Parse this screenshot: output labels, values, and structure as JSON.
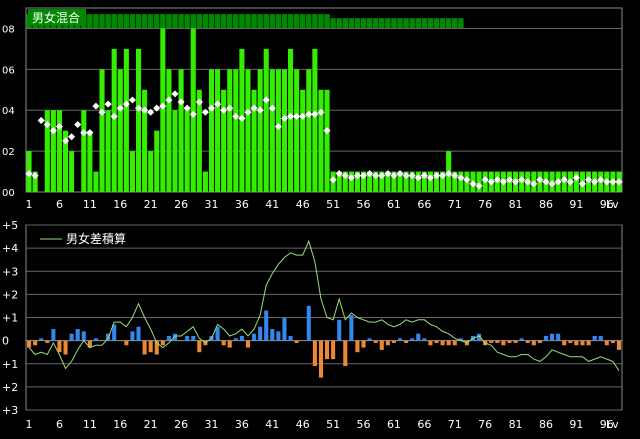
{
  "chart_data": [
    {
      "type": "bar",
      "title": "男女混合",
      "xlabel": "Lv",
      "ylabel": "",
      "xlim": [
        1,
        99
      ],
      "ylim": [
        0,
        0.09
      ],
      "x_ticks": [
        "1",
        "6",
        "11",
        "16",
        "21",
        "26",
        "31",
        "36",
        "41",
        "46",
        "51",
        "56",
        "61",
        "66",
        "71",
        "76",
        "81",
        "86",
        "91",
        "96",
        "Lv"
      ],
      "y_ticks": [
        "00",
        "02",
        "04",
        "06",
        "08"
      ],
      "bar_color": "#33ee00",
      "marker_color": "#ffffff",
      "grid": true,
      "series": [
        {
          "values": [
            0.02,
            0.01,
            0,
            0.04,
            0.04,
            0.04,
            0.03,
            0.02,
            0,
            0.04,
            0.03,
            0.01,
            0.06,
            0.04,
            0.07,
            0.06,
            0.07,
            0.02,
            0.07,
            0.05,
            0.02,
            0.03,
            0.08,
            0.06,
            0.04,
            0.06,
            0.04,
            0.08,
            0.05,
            0.01,
            0.06,
            0.06,
            0.05,
            0.06,
            0.06,
            0.07,
            0.06,
            0.05,
            0.06,
            0.07,
            0.06,
            0.06,
            0.06,
            0.07,
            0.06,
            0.05,
            0.06,
            0.07,
            0.05,
            0.05,
            0.01,
            0.01,
            0.01,
            0.01,
            0.01,
            0.01,
            0.01,
            0.01,
            0.01,
            0.01,
            0.01,
            0.01,
            0.01,
            0.01,
            0.01,
            0.01,
            0.01,
            0.01,
            0.01,
            0.02,
            0.01,
            0.01,
            0.01,
            0.01,
            0.01,
            0.01,
            0.01,
            0.01,
            0.01,
            0.01,
            0.01,
            0.01,
            0.01,
            0.01,
            0.01,
            0.01,
            0.01,
            0.01,
            0.01,
            0.01,
            0.01,
            0.01,
            0.01,
            0.01,
            0.01,
            0.01,
            0.01,
            0.01
          ]
        },
        {
          "values": [
            0.009,
            0.008,
            0.035,
            0.033,
            0.03,
            0.032,
            0.025,
            0.027,
            0.033,
            0.029,
            0.029,
            0.042,
            0.039,
            0.043,
            0.037,
            0.041,
            0.043,
            0.045,
            0.041,
            0.04,
            0.039,
            0.041,
            0.042,
            0.045,
            0.048,
            0.044,
            0.041,
            0.038,
            0.044,
            0.039,
            0.041,
            0.043,
            0.04,
            0.041,
            0.037,
            0.036,
            0.039,
            0.041,
            0.04,
            0.045,
            0.041,
            0.032,
            0.036,
            0.037,
            0.037,
            0.037,
            0.038,
            0.038,
            0.039,
            0.03,
            0.006,
            0.009,
            0.008,
            0.007,
            0.008,
            0.008,
            0.009,
            0.008,
            0.008,
            0.009,
            0.008,
            0.009,
            0.008,
            0.008,
            0.007,
            0.008,
            0.007,
            0.008,
            0.008,
            0.009,
            0.008,
            0.007,
            0.006,
            0.004,
            0.003,
            0.006,
            0.005,
            0.006,
            0.005,
            0.006,
            0.005,
            0.006,
            0.005,
            0.004,
            0.006,
            0.005,
            0.004,
            0.005,
            0.006,
            0.005,
            0.007,
            0.004,
            0.006,
            0.005,
            0.006,
            0.005,
            0.005,
            0.005
          ]
        }
      ],
      "header_band": {
        "color": "#008800",
        "values": [
          0.087,
          0.087,
          0.087,
          0.087,
          0.087,
          0.087,
          0.087,
          0.087,
          0.087,
          0.087,
          0.087,
          0.087,
          0.087,
          0.087,
          0.087,
          0.087,
          0.087,
          0.087,
          0.087,
          0.087,
          0.087,
          0.087,
          0.087,
          0.087,
          0.087,
          0.087,
          0.087,
          0.087,
          0.087,
          0.087,
          0.087,
          0.087,
          0.087,
          0.087,
          0.087,
          0.087,
          0.087,
          0.087,
          0.087,
          0.087,
          0.087,
          0.087,
          0.087,
          0.087,
          0.087,
          0.087,
          0.087,
          0.087,
          0.087,
          0.087,
          0.085,
          0.085,
          0.085,
          0.085,
          0.085,
          0.085,
          0.085,
          0.085,
          0.085,
          0.085,
          0.085,
          0.085,
          0.085,
          0.085,
          0.085,
          0.085,
          0.085,
          0.085,
          0.085,
          0.085,
          0.085,
          0.085
        ]
      }
    },
    {
      "type": "bar",
      "title": "",
      "xlabel": "Lv",
      "ylabel": "",
      "xlim": [
        1,
        99
      ],
      "ylim": [
        -3,
        5
      ],
      "x_ticks": [
        "1",
        "6",
        "11",
        "16",
        "21",
        "26",
        "31",
        "36",
        "41",
        "46",
        "51",
        "56",
        "61",
        "66",
        "71",
        "76",
        "81",
        "86",
        "91",
        "96",
        "Lv"
      ],
      "y_ticks": [
        "+5",
        "+4",
        "+3",
        "+2",
        "+1",
        "0",
        "+1",
        "+2",
        "+3"
      ],
      "grid": true,
      "positive_color": "#3388ee",
      "negative_color": "#ee8833",
      "legend": [
        {
          "name": "男女差積算",
          "color": "#99dd77"
        }
      ],
      "legend_position": "top-left",
      "series": [
        {
          "name": "bars",
          "values": [
            -0.3,
            -0.2,
            0.1,
            -0.1,
            0.5,
            -0.5,
            -0.6,
            0.3,
            0.5,
            0.4,
            -0.3,
            0.1,
            0,
            0.3,
            0.7,
            0,
            -0.2,
            0.4,
            0.6,
            -0.6,
            -0.5,
            -0.6,
            -0.2,
            0.2,
            0.3,
            0,
            0.2,
            0.2,
            -0.5,
            -0.2,
            0.2,
            0.6,
            -0.2,
            -0.3,
            0.1,
            0.2,
            -0.3,
            0.3,
            0.6,
            1.3,
            0.5,
            0.4,
            1.0,
            0.2,
            -0.1,
            0,
            1.5,
            -1.1,
            -1.6,
            -0.8,
            -0.8,
            0.9,
            -1.1,
            1.1,
            -0.5,
            -0.3,
            0.1,
            -0.1,
            -0.4,
            -0.2,
            -0.1,
            0.1,
            -0.1,
            0.1,
            0.3,
            0.1,
            -0.2,
            -0.1,
            -0.2,
            -0.2,
            -0.2,
            0.1,
            -0.2,
            0.2,
            0.3,
            -0.2,
            -0.1,
            -0.1,
            -0.2,
            -0.1,
            -0.1,
            0.1,
            -0.1,
            -0.2,
            -0.1,
            0.2,
            0.3,
            0.3,
            -0.2,
            -0.1,
            -0.2,
            -0.2,
            -0.2,
            0.2,
            0.2,
            -0.2,
            -0.1,
            -0.4
          ]
        },
        {
          "name": "男女差積算",
          "values": [
            -0.3,
            -0.6,
            -0.5,
            -0.6,
            -0.1,
            -0.6,
            -1.2,
            -0.9,
            -0.4,
            0,
            -0.3,
            -0.2,
            -0.2,
            0.1,
            0.8,
            0.8,
            0.6,
            1.0,
            1.6,
            1.0,
            0.5,
            -0.1,
            -0.3,
            -0.1,
            0.2,
            0.2,
            0.4,
            0.6,
            0.1,
            -0.1,
            0.1,
            0.7,
            0.5,
            0.2,
            0.3,
            0.5,
            0.2,
            0.5,
            1.1,
            2.4,
            2.9,
            3.3,
            3.6,
            3.8,
            3.7,
            3.7,
            4.3,
            3.4,
            1.8,
            1.0,
            0.9,
            1.8,
            0.9,
            1.2,
            1.0,
            0.9,
            0.8,
            0.8,
            0.9,
            0.7,
            0.6,
            0.7,
            0.9,
            0.8,
            0.9,
            0.9,
            0.7,
            0.6,
            0.4,
            0.3,
            0.1,
            0.0,
            -0.1,
            0.1,
            0.2,
            -0.1,
            -0.2,
            -0.5,
            -0.6,
            -0.7,
            -0.7,
            -0.6,
            -0.6,
            -0.8,
            -0.9,
            -0.7,
            -0.4,
            -0.5,
            -0.6,
            -0.7,
            -0.7,
            -0.7,
            -0.9,
            -0.8,
            -0.7,
            -0.8,
            -0.9,
            -1.3
          ]
        }
      ]
    }
  ]
}
